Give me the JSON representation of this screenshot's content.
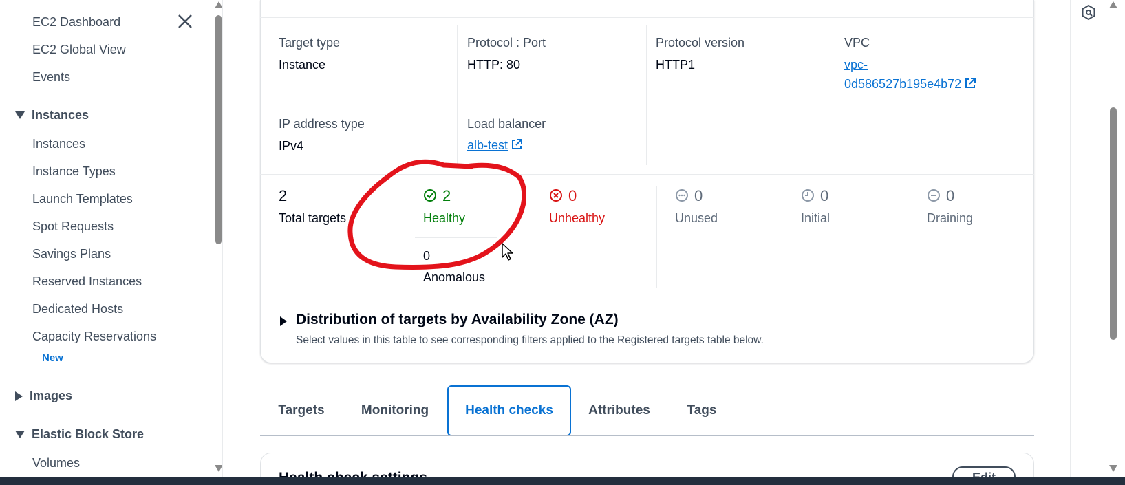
{
  "sidebar": {
    "items": [
      {
        "label": "EC2 Dashboard"
      },
      {
        "label": "EC2 Global View"
      },
      {
        "label": "Events"
      }
    ],
    "instances_section": {
      "label": "Instances",
      "items": [
        {
          "label": "Instances"
        },
        {
          "label": "Instance Types"
        },
        {
          "label": "Launch Templates"
        },
        {
          "label": "Spot Requests"
        },
        {
          "label": "Savings Plans"
        },
        {
          "label": "Reserved Instances"
        },
        {
          "label": "Dedicated Hosts"
        },
        {
          "label": "Capacity Reservations"
        }
      ],
      "new_badge": "New"
    },
    "images_section": {
      "label": "Images"
    },
    "ebs_section": {
      "label": "Elastic Block Store",
      "items": [
        {
          "label": "Volumes"
        }
      ]
    }
  },
  "details": {
    "target_type": {
      "label": "Target type",
      "value": "Instance"
    },
    "protocol_port": {
      "label": "Protocol : Port",
      "value": "HTTP: 80"
    },
    "protocol_version": {
      "label": "Protocol version",
      "value": "HTTP1"
    },
    "vpc": {
      "label": "VPC",
      "value_line1": "vpc-",
      "value_line2": "0d586527b195e4b72"
    },
    "ip_address_type": {
      "label": "IP address type",
      "value": "IPv4"
    },
    "load_balancer": {
      "label": "Load balancer",
      "value": "alb-test"
    }
  },
  "targets_summary": {
    "total": {
      "count": "2",
      "label": "Total targets"
    },
    "healthy": {
      "count": "2",
      "label": "Healthy",
      "color": "#037f0c"
    },
    "anomalous": {
      "count": "0",
      "label": "Anomalous"
    },
    "unhealthy": {
      "count": "0",
      "label": "Unhealthy",
      "color": "#d91515"
    },
    "unused": {
      "count": "0",
      "label": "Unused"
    },
    "initial": {
      "count": "0",
      "label": "Initial"
    },
    "draining": {
      "count": "0",
      "label": "Draining"
    }
  },
  "distribution": {
    "title": "Distribution of targets by Availability Zone (AZ)",
    "description": "Select values in this table to see corresponding filters applied to the Registered targets table below."
  },
  "tabs": [
    {
      "label": "Targets",
      "active": false
    },
    {
      "label": "Monitoring",
      "active": false
    },
    {
      "label": "Health checks",
      "active": true
    },
    {
      "label": "Attributes",
      "active": false
    },
    {
      "label": "Tags",
      "active": false
    }
  ],
  "health_check_settings": {
    "title": "Health check settings",
    "edit_label": "Edit"
  },
  "colors": {
    "link": "#0972d3",
    "healthy": "#037f0c",
    "unhealthy": "#d91515",
    "annotation": "#e3131b"
  }
}
